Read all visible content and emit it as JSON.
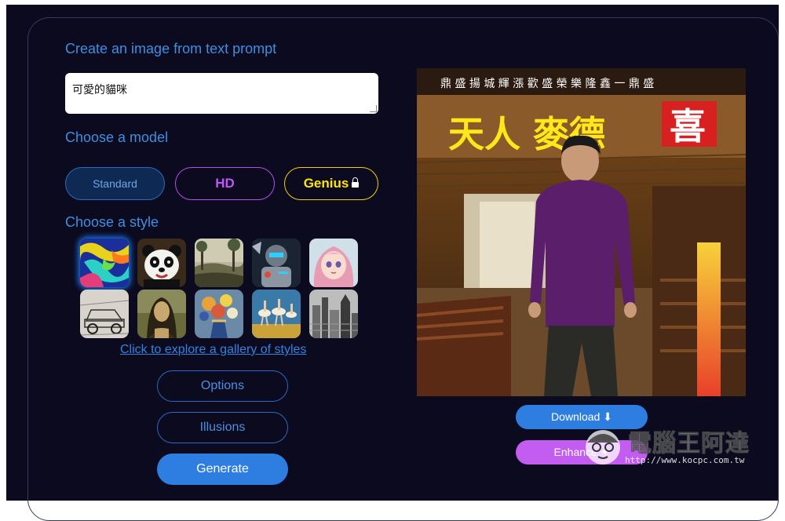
{
  "create": {
    "heading": "Create an image from text prompt",
    "prompt_value": "可愛的貓咪"
  },
  "model": {
    "heading": "Choose a model",
    "options": [
      {
        "label": "Standard",
        "state": "selected"
      },
      {
        "label": "HD",
        "color": "#c056f5"
      },
      {
        "label": "Genius",
        "color": "#ffe600",
        "locked": true
      }
    ]
  },
  "style": {
    "heading": "Choose a style",
    "thumbnails": [
      "abstract",
      "panda",
      "landscape",
      "robot",
      "anime-girl",
      "sketch-car",
      "mona-lisa",
      "flowers",
      "ballet",
      "city-sketch"
    ],
    "selected": "abstract",
    "gallery_link": "Click to explore a gallery of styles"
  },
  "buttons": {
    "options": "Options",
    "illusions": "Illusions",
    "generate": "Generate"
  },
  "result": {
    "sign_text": "天人 麥德",
    "sign_red": "喜",
    "banner_text": "鼎 盛 揚 城 輝 漲 歡 盛 榮 樂 隆 鑫 一 鼎 盛",
    "download": "Download ⬇",
    "enhance": "Enhance ✦"
  },
  "watermark": {
    "title": "電腦王阿達",
    "url": "http://www.kocpc.com.tw"
  },
  "colors": {
    "background": "#0b0a1f",
    "accent": "#2d7ee0",
    "hd": "#c056f5",
    "genius": "#ffe600"
  }
}
